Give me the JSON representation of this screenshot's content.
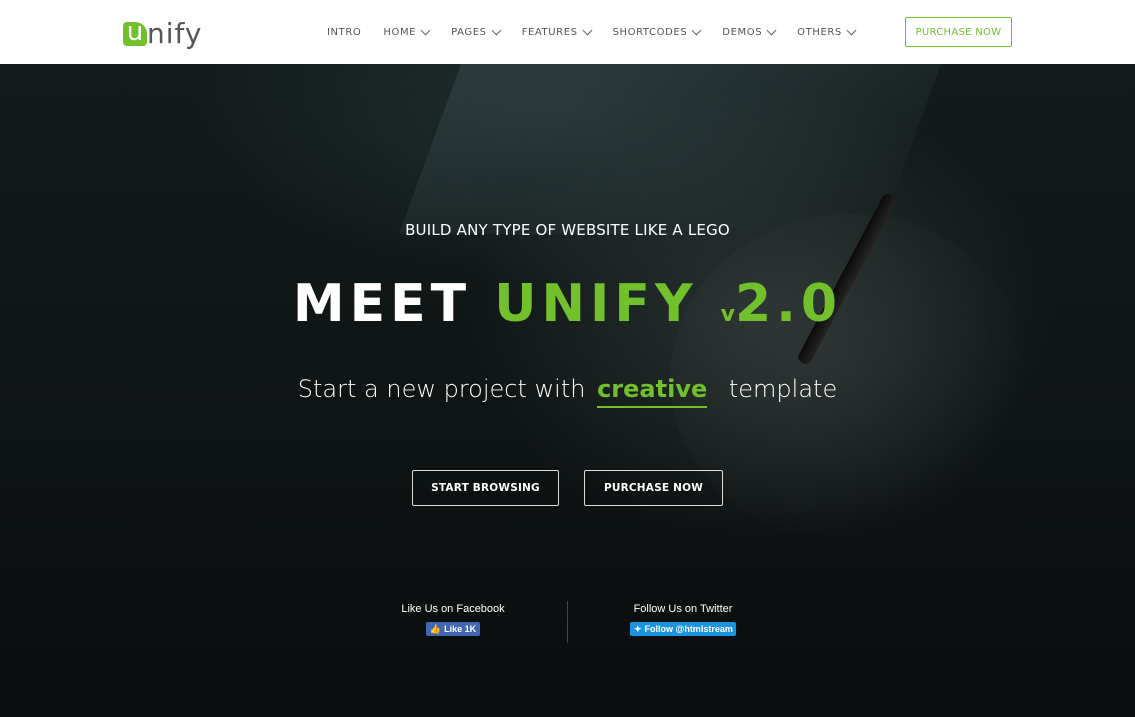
{
  "header": {
    "logo": {
      "first_letter": "u",
      "rest": "nify"
    },
    "nav": [
      {
        "label": "INTRO",
        "has_dropdown": false
      },
      {
        "label": "HOME",
        "has_dropdown": true
      },
      {
        "label": "PAGES",
        "has_dropdown": true
      },
      {
        "label": "FEATURES",
        "has_dropdown": true
      },
      {
        "label": "SHORTCODES",
        "has_dropdown": true
      },
      {
        "label": "DEMOS",
        "has_dropdown": true
      },
      {
        "label": "OTHERS",
        "has_dropdown": true
      }
    ],
    "purchase_label": "PURCHASE NOW"
  },
  "hero": {
    "kicker": "BUILD ANY TYPE OF WEBSITE LIKE A LEGO",
    "title_white": "MEET",
    "title_green": "UNIFY",
    "title_v": "v",
    "title_version": "2.0",
    "subtitle_pre": "Start a new project with",
    "subtitle_highlight": "creative",
    "subtitle_post": "template",
    "start_label": "START BROWSING",
    "purchase_label": "PURCHASE NOW"
  },
  "social": {
    "facebook_label": "Like Us on Facebook",
    "facebook_button": "Like 1K",
    "twitter_label": "Follow Us on Twitter",
    "twitter_button": "Follow @htmlstream"
  },
  "colors": {
    "accent": "#72c02c",
    "facebook": "#4267b2",
    "twitter": "#1b95e0"
  }
}
